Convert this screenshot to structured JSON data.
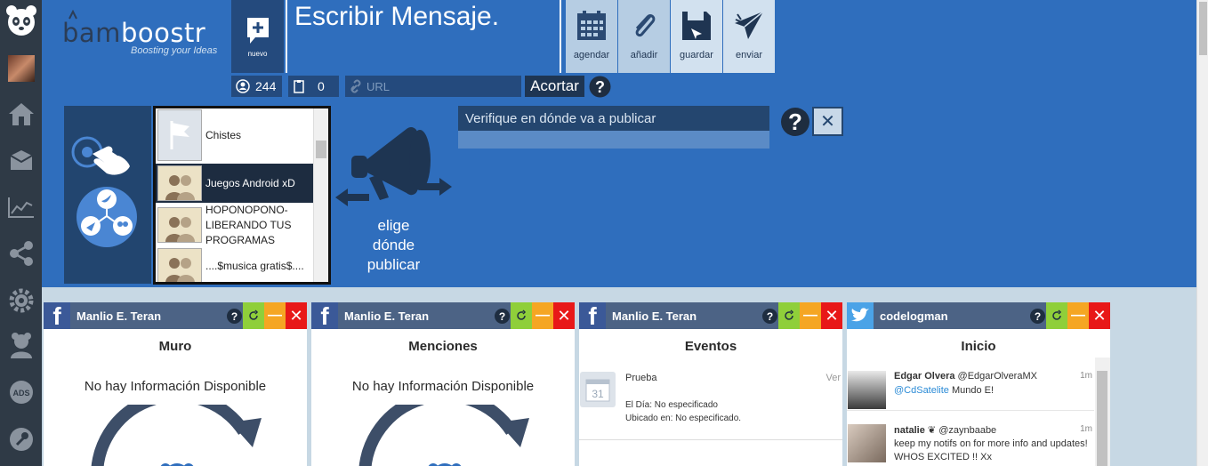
{
  "nav": {
    "items": [
      {
        "icon": "panda-icon"
      },
      {
        "icon": "profile-photo"
      },
      {
        "icon": "home-icon"
      },
      {
        "icon": "inbox-icon"
      },
      {
        "icon": "stats-icon"
      },
      {
        "icon": "share-icon"
      },
      {
        "icon": "settings-icon"
      },
      {
        "icon": "user-icon"
      },
      {
        "icon": "ads-icon"
      },
      {
        "icon": "wrench-icon"
      }
    ],
    "ads_label": "ADS"
  },
  "brand": {
    "name_part1": "bam",
    "name_part2": "boostr",
    "tagline": "Boosting your Ideas"
  },
  "compose": {
    "title": "Escribir Mensaje.",
    "new_label": "nuevo"
  },
  "toolbar": {
    "schedule": "agendar",
    "attach": "añadir",
    "save": "guardar",
    "send": "enviar"
  },
  "counters": {
    "followers": "244",
    "pending": "0"
  },
  "shortener": {
    "placeholder": "URL",
    "button": "Acortar"
  },
  "pages": [
    {
      "label": "Chistes"
    },
    {
      "label": "Juegos Android xD"
    },
    {
      "label": "HOPONOPONO-\nLIBERANDO TUS\nPROGRAMAS"
    },
    {
      "label": "....$musica gratis$...."
    }
  ],
  "target": {
    "choose_line1": "elige",
    "choose_line2": "dónde",
    "choose_line3": "publicar"
  },
  "verify": {
    "text": "Verifique en dónde va a publicar"
  },
  "columns": [
    {
      "network": "facebook",
      "account": "Manlio E. Teran",
      "title": "Muro",
      "empty": "No hay Información Disponible"
    },
    {
      "network": "facebook",
      "account": "Manlio E. Teran",
      "title": "Menciones",
      "empty": "No hay Información Disponible"
    },
    {
      "network": "facebook",
      "account": "Manlio E. Teran",
      "title": "Eventos",
      "event": {
        "name": "Prueba",
        "action": "Ver",
        "day": "El Día: No especificado",
        "location": "Ubicado en: No especificado.",
        "calendar_day": "31"
      }
    },
    {
      "network": "twitter",
      "account": "codelogman",
      "title": "Inicio",
      "tweets": [
        {
          "name": "Edgar Olvera",
          "handle": "@EdgarOlveraMX",
          "time": "1m",
          "mention": "@CdSatelite",
          "text": " Mundo E!"
        },
        {
          "name": "natalie ❦",
          "handle": "@zaynbaabe",
          "time": "1m",
          "mention": "",
          "text": "keep my notifs on for more info and updates! WHOS EXCITED !! Xx"
        }
      ]
    }
  ],
  "colors": {
    "primary": "#2f6ebd",
    "dark": "#2f3a46",
    "refresh": "#8fcf3a",
    "minimize": "#f5a623",
    "close": "#e81818"
  }
}
